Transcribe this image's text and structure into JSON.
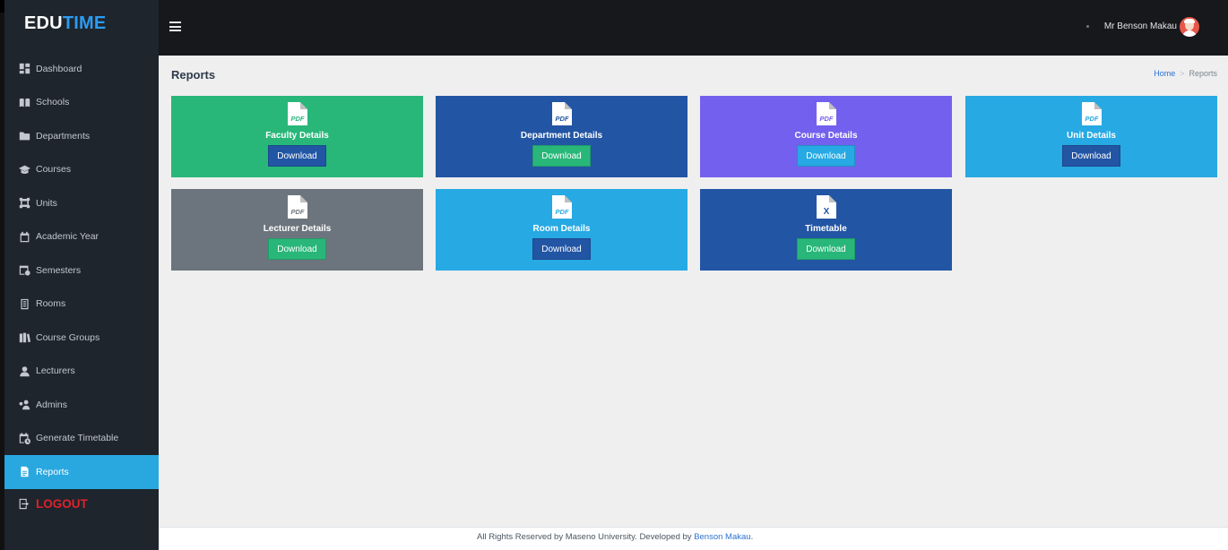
{
  "brand": {
    "part1": "EDU",
    "part2": "TIME"
  },
  "sidebar": {
    "items": [
      {
        "label": "Dashboard",
        "icon": "dashboard-icon"
      },
      {
        "label": "Schools",
        "icon": "book-open-icon"
      },
      {
        "label": "Departments",
        "icon": "folder-icon"
      },
      {
        "label": "Courses",
        "icon": "graduation-cap-icon"
      },
      {
        "label": "Units",
        "icon": "vector-square-icon"
      },
      {
        "label": "Academic Year",
        "icon": "calendar-icon"
      },
      {
        "label": "Semesters",
        "icon": "calendar-week-icon"
      },
      {
        "label": "Rooms",
        "icon": "building-icon"
      },
      {
        "label": "Course Groups",
        "icon": "books-icon"
      },
      {
        "label": "Lecturers",
        "icon": "user-icon"
      },
      {
        "label": "Admins",
        "icon": "user-cog-icon"
      },
      {
        "label": "Generate Timetable",
        "icon": "calendar-clock-icon"
      },
      {
        "label": "Reports",
        "icon": "file-icon",
        "active": true
      }
    ],
    "logout_label": "LOGOUT"
  },
  "topbar": {
    "username": "Mr Benson Makau"
  },
  "page": {
    "title": "Reports",
    "breadcrumb": {
      "home": "Home",
      "current": "Reports"
    }
  },
  "cards": [
    {
      "title": "Faculty Details",
      "button": "Download",
      "icon": "file-pdf-icon",
      "bg": "#28b779",
      "btn_bg": "#2255a4"
    },
    {
      "title": "Department Details",
      "button": "Download",
      "icon": "file-pdf-icon",
      "bg": "#2255a4",
      "btn_bg": "#28b779"
    },
    {
      "title": "Course Details",
      "button": "Download",
      "icon": "file-pdf-icon",
      "bg": "#7460ee",
      "btn_bg": "#27a9e3"
    },
    {
      "title": "Unit Details",
      "button": "Download",
      "icon": "file-pdf-icon",
      "bg": "#27a9e3",
      "btn_bg": "#2255a4"
    },
    {
      "title": "Lecturer Details",
      "button": "Download",
      "icon": "file-pdf-icon",
      "bg": "#6c757d",
      "btn_bg": "#28b779"
    },
    {
      "title": "Room Details",
      "button": "Download",
      "icon": "file-pdf-icon",
      "bg": "#27a9e3",
      "btn_bg": "#2255a4"
    },
    {
      "title": "Timetable",
      "button": "Download",
      "icon": "file-excel-icon",
      "bg": "#2255a4",
      "btn_bg": "#28b779"
    }
  ],
  "footer": {
    "text": "All Rights Reserved by Maseno University. Developed by ",
    "link": "Benson Makau",
    "end": "."
  }
}
